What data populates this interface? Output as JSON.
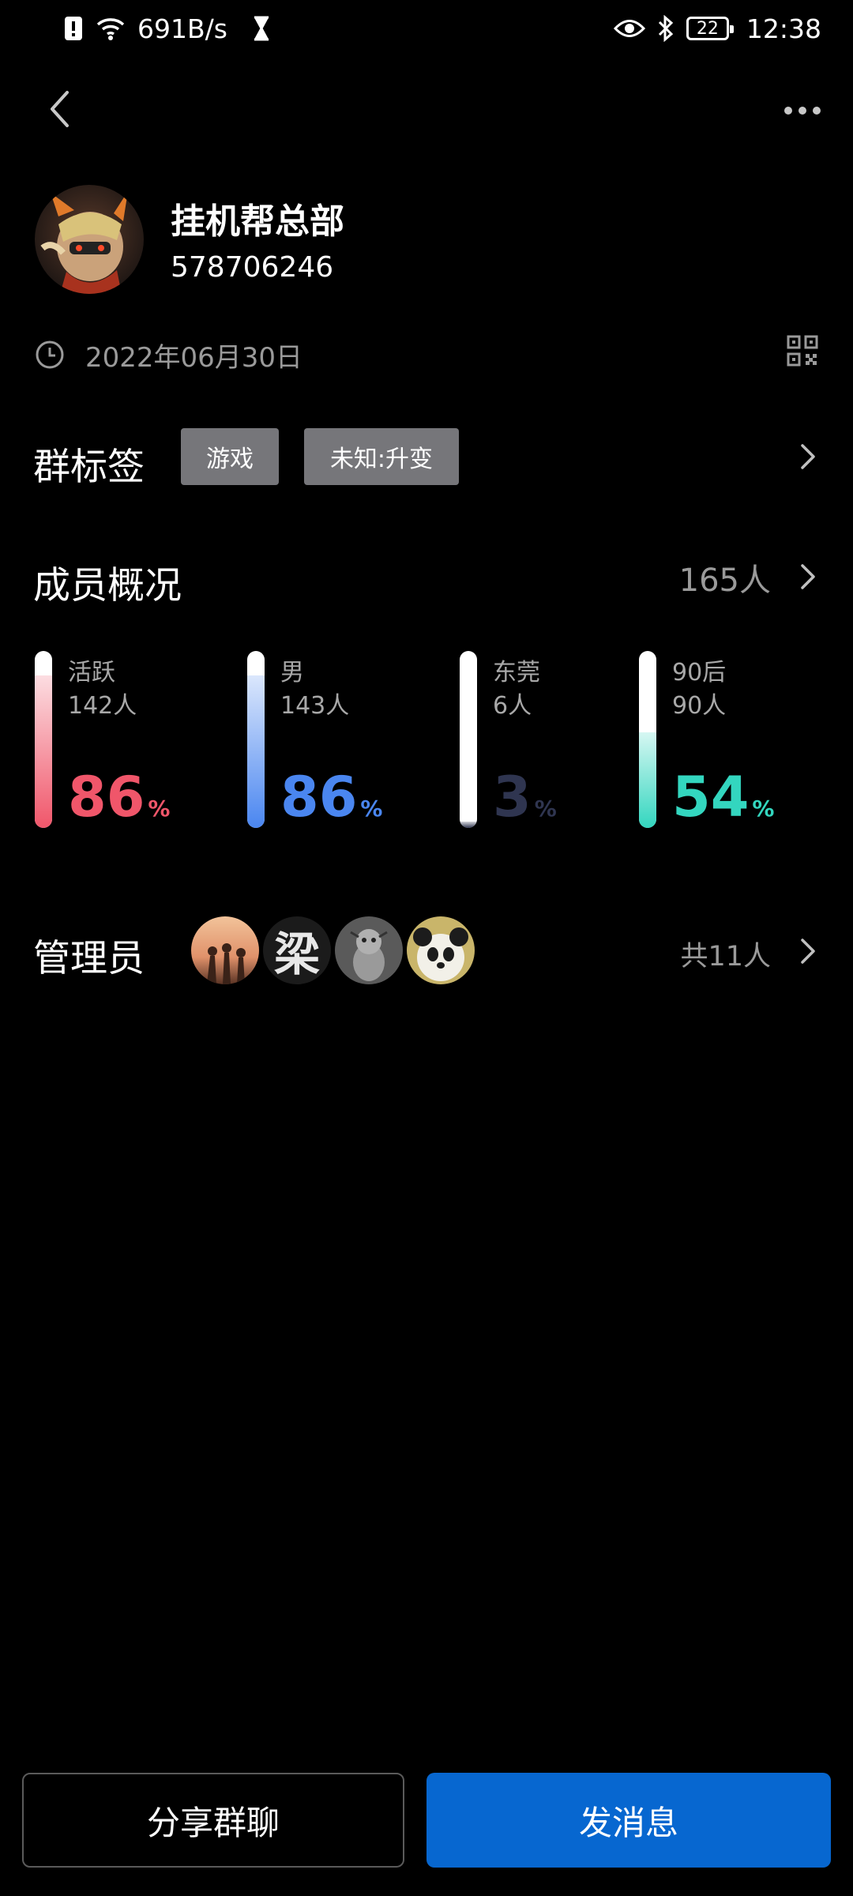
{
  "status_bar": {
    "network_speed": "691B/s",
    "battery": "22",
    "time": "12:38"
  },
  "group": {
    "name": "挂机帮总部",
    "id": "578706246",
    "created_date": "2022年06月30日"
  },
  "tags": {
    "label": "群标签",
    "items": [
      "游戏",
      "未知:升变"
    ]
  },
  "members": {
    "label": "成员概况",
    "count": "165人",
    "stats": [
      {
        "name": "活跃",
        "count": "142人",
        "percent": "86",
        "unit": "%",
        "fill": 0.86,
        "color": "#f0566a"
      },
      {
        "name": "男",
        "count": "143人",
        "percent": "86",
        "unit": "%",
        "fill": 0.86,
        "color": "#4a86f0"
      },
      {
        "name": "东莞",
        "count": "6人",
        "percent": "3",
        "unit": "%",
        "fill": 0.03,
        "color": "#2f3550"
      },
      {
        "name": "90后",
        "count": "90人",
        "percent": "54",
        "unit": "%",
        "fill": 0.54,
        "color": "#33d6bf"
      }
    ]
  },
  "admins": {
    "label": "管理员",
    "count": "共11人",
    "avatar_glyph": "梁"
  },
  "actions": {
    "share": "分享群聊",
    "send": "发消息"
  }
}
